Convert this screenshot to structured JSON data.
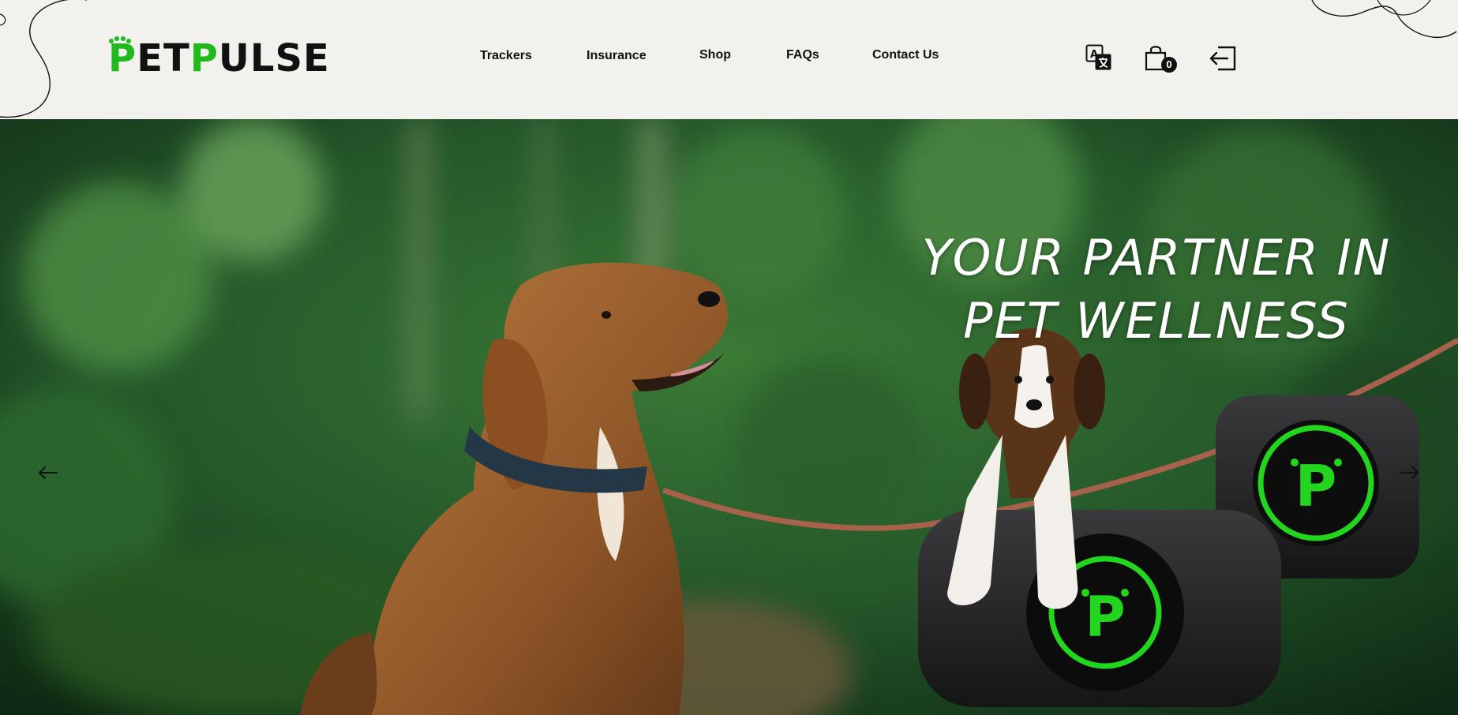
{
  "brand": {
    "logo_text_1": "P",
    "logo_text_2": "ET",
    "logo_text_3": "P",
    "logo_text_4": "ULSE",
    "accent_color": "#22b91d"
  },
  "nav": {
    "items": [
      {
        "label": "Trackers"
      },
      {
        "label": "Insurance"
      },
      {
        "label": "Shop"
      },
      {
        "label": "FAQs"
      },
      {
        "label": "Contact Us"
      }
    ]
  },
  "header_icons": {
    "translate": "translate-icon",
    "cart": "shopping-bag-icon",
    "cart_count": "0",
    "login": "login-icon"
  },
  "hero": {
    "title_line_1": "YOUR PARTNER IN",
    "title_line_2": "PET WELLNESS",
    "prev_arrow": "arrow-left-icon",
    "next_arrow": "arrow-right-icon"
  }
}
